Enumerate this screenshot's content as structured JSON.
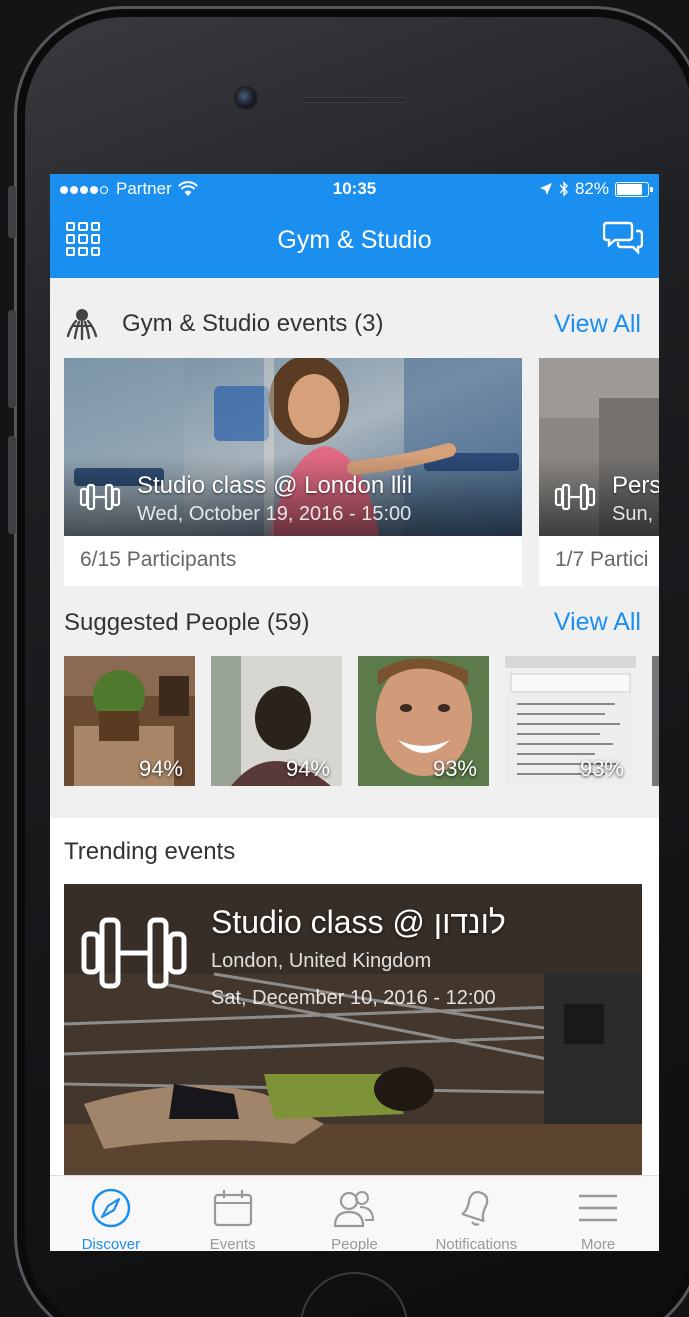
{
  "status_bar": {
    "carrier": "Partner",
    "time": "10:35",
    "battery": "82%",
    "battery_level": 0.82
  },
  "nav": {
    "title": "Gym & Studio",
    "left_icon": "grid-menu-icon",
    "right_icon": "chat-bubbles-icon"
  },
  "gym_events": {
    "title": "Gym & Studio events (3)",
    "view_all": "View All",
    "items": [
      {
        "name": "Studio class @ London llil",
        "date": "Wed, October 19, 2016 - 15:00",
        "participants": "6/15 Participants"
      },
      {
        "name": "Pers",
        "date": "Sun,",
        "participants": "1/7 Partici"
      }
    ]
  },
  "suggested_people": {
    "title": "Suggested People (59)",
    "view_all": "View All",
    "items": [
      {
        "match": "94%"
      },
      {
        "match": "94%"
      },
      {
        "match": "93%"
      },
      {
        "match": "93%"
      }
    ]
  },
  "trending": {
    "title": "Trending events",
    "event": {
      "name": "Studio class @ לונדון",
      "location": "London, United Kingdom",
      "date": "Sat, December 10, 2016 - 12:00"
    }
  },
  "tabs": [
    {
      "label": "Discover",
      "icon": "compass-icon",
      "active": true
    },
    {
      "label": "Events",
      "icon": "calendar-icon",
      "active": false
    },
    {
      "label": "People",
      "icon": "people-icon",
      "active": false
    },
    {
      "label": "Notifications",
      "icon": "bell-icon",
      "active": false
    },
    {
      "label": "More",
      "icon": "hamburger-icon",
      "active": false
    }
  ],
  "colors": {
    "accent": "#1b8ff0",
    "background": "#f0f0f0"
  }
}
